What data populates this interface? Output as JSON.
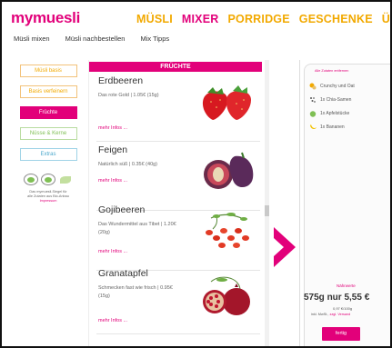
{
  "header": {
    "logo": "mymuesli",
    "nav": [
      "MÜSLI",
      "MIXER",
      "PORRIDGE",
      "GESCHENKE",
      "ÜBER UN"
    ],
    "nav_active_index": 1,
    "subnav": [
      "Müsli mixen",
      "Müsli nachbestellen",
      "Mix Tipps"
    ]
  },
  "sidebar": {
    "buttons": [
      "Müsli basis",
      "Basis verfeinern",
      "Früchte",
      "Nüsse & Kerne",
      "Extras"
    ],
    "active_index": 2,
    "badges": [
      "bio-seal-icon",
      "eu-bio-icon",
      "leaf-icon"
    ],
    "note_lines": [
      "Das mymuesli-Siegel für",
      "alle Zutaten aus Bio-Anbau"
    ],
    "note_link": "Impressum"
  },
  "list": {
    "category": "FRÜCHTE",
    "products": [
      {
        "name": "Erdbeeren",
        "desc": "Das rote Gold | 1.05€ (15g)",
        "more": "mehr Infos ...",
        "image": "strawberry-icon"
      },
      {
        "name": "Feigen",
        "desc": "Natürlich süß | 0.35€ (40g)",
        "more": "mehr Infos ...",
        "image": "fig-icon"
      },
      {
        "name": "Gojibeeren",
        "desc": "Das Wundermittel aus Tibet | 1.20€ (20g)",
        "more": "mehr Infos ...",
        "image": "goji-icon"
      },
      {
        "name": "Granatapfel",
        "desc": "Schmecken fast wie frisch | 0.95€ (15g)",
        "more": "mehr Infos ...",
        "image": "pomegranate-icon"
      }
    ]
  },
  "cup": {
    "note": "Alle Zutaten entfernen",
    "ingredients": [
      {
        "label": "Crunchy und Oat",
        "icon": "crunchy-icon",
        "color": "#f2a900"
      },
      {
        "label": "1x Chia-Samen",
        "icon": "chia-icon",
        "color": "#555555"
      },
      {
        "label": "1x Apfelstücke",
        "icon": "apple-icon",
        "color": "#7fbf54"
      },
      {
        "label": "1x Bananen",
        "icon": "banana-icon",
        "color": "#f2c200"
      }
    ],
    "nutrition_link": "Nährwerte",
    "price": "575g nur 5,55 €",
    "unit_price": "0,97 €/100g",
    "vat_text": "inkl. MwSt., ",
    "shipping_link": "zzgl. Versand",
    "done_label": "fertig"
  },
  "colors": {
    "brand": "#e2007a",
    "nav": "#f2a900",
    "green": "#7fbf54",
    "blue": "#4aa8cc"
  }
}
